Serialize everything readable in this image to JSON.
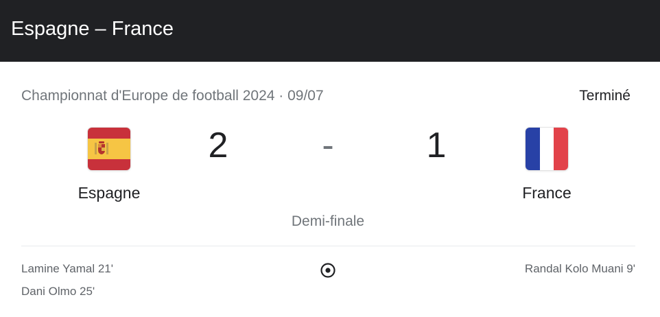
{
  "header": {
    "title": "Espagne – France"
  },
  "match": {
    "competition": "Championnat d'Europe de football 2024 · 09/07",
    "status": "Terminé",
    "stage": "Demi-finale",
    "score_separator": "-",
    "home": {
      "name": "Espagne",
      "score": "2",
      "flag_icon": "spain-flag-icon",
      "scorers": [
        "Lamine Yamal 21'",
        "Dani Olmo 25'"
      ]
    },
    "away": {
      "name": "France",
      "score": "1",
      "flag_icon": "france-flag-icon",
      "scorers": [
        "Randal Kolo Muani 9'"
      ]
    },
    "goal_icon": "soccer-ball-icon"
  },
  "colors": {
    "header_bg": "#202124",
    "spain_red": "#c8313b",
    "spain_yellow": "#f6c544",
    "france_blue": "#2841a6",
    "france_red": "#e2424a"
  }
}
